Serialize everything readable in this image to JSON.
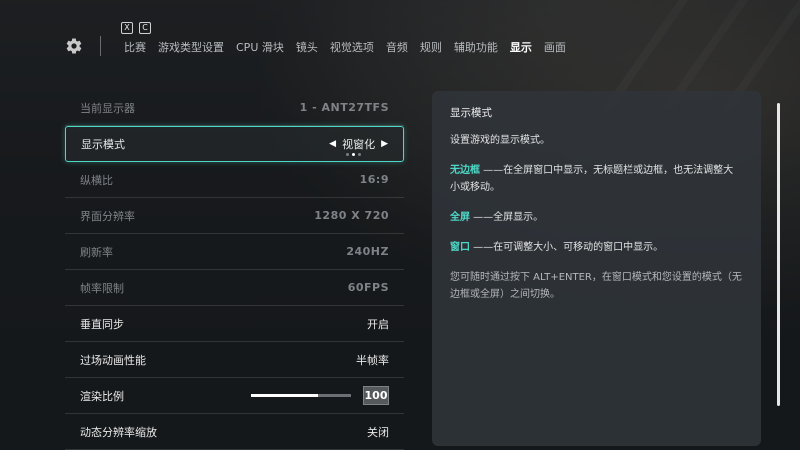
{
  "keys": [
    "X",
    "C"
  ],
  "nav": {
    "tabs": [
      "比赛",
      "游戏类型设置",
      "CPU 滑块",
      "镜头",
      "视觉选项",
      "音频",
      "规则",
      "辅助功能",
      "显示",
      "画面"
    ],
    "active_index": 8
  },
  "settings": {
    "rows": [
      {
        "label": "当前显示器",
        "value": "1 - ANT27TFS",
        "state": "disabled"
      },
      {
        "label": "显示模式",
        "value": "视窗化",
        "state": "selected",
        "dots": 3,
        "dot_active": 1
      },
      {
        "label": "纵横比",
        "value": "16:9",
        "state": "disabled"
      },
      {
        "label": "界面分辨率",
        "value": "1280 X 720",
        "state": "disabled"
      },
      {
        "label": "刷新率",
        "value": "240HZ",
        "state": "disabled"
      },
      {
        "label": "帧率限制",
        "value": "60FPS",
        "state": "disabled"
      },
      {
        "label": "垂直同步",
        "value": "开启",
        "state": "normal"
      },
      {
        "label": "过场动画性能",
        "value": "半帧率",
        "state": "normal"
      },
      {
        "label": "渲染比例",
        "value": "100",
        "state": "slider",
        "slider_fraction": 0.67
      },
      {
        "label": "动态分辨率缩放",
        "value": "关闭",
        "state": "normal"
      }
    ]
  },
  "panel": {
    "title": "显示模式",
    "intro": "设置游戏的显示模式。",
    "items": [
      {
        "term": "无边框",
        "desc": " ——在全屏窗口中显示，无标题栏或边框，也无法调整大小或移动。"
      },
      {
        "term": "全屏",
        "desc": " ——全屏显示。"
      },
      {
        "term": "窗口",
        "desc": " ——在可调整大小、可移动的窗口中显示。"
      }
    ],
    "note": "您可随时通过按下 ALT+ENTER，在窗口模式和您设置的模式（无边框或全屏）之间切换。"
  },
  "colors": {
    "accent": "#4ed6c6"
  },
  "icons": {
    "settings": "gear-icon"
  }
}
